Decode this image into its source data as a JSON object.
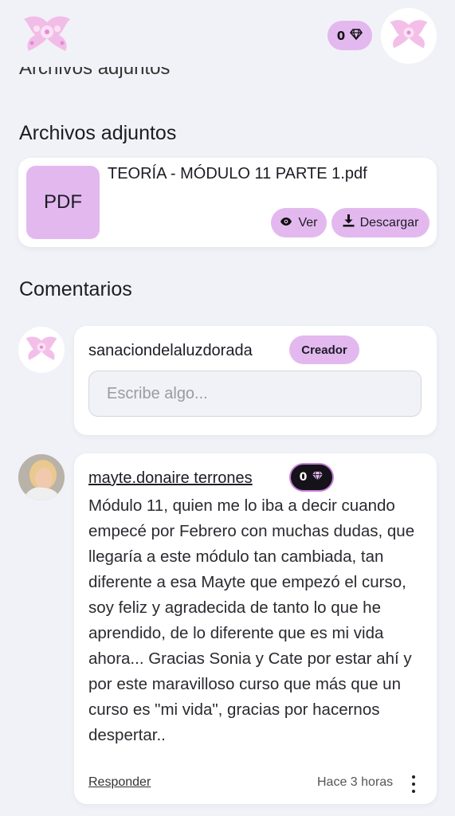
{
  "header": {
    "gem_count": "0"
  },
  "cut_heading": "Archivos adjuntos",
  "attachments": {
    "title": "Archivos adjuntos",
    "file": {
      "thumb_label": "PDF",
      "name": "TEORÍA - MÓDULO  11 PARTE 1.pdf",
      "view_label": "Ver",
      "download_label": "Descargar"
    }
  },
  "comments": {
    "title": "Comentarios",
    "composer": {
      "username": "sanaciondelaluzdorada",
      "badge": "Creador",
      "placeholder": "Escribe algo..."
    },
    "items": [
      {
        "username": "mayte.donaire terrones",
        "gem_count": "0",
        "text": "Módulo 11, quien me lo iba a decir cuando empecé por Febrero con muchas dudas, que llegaría a este módulo tan cambiada, tan diferente a esa Mayte que empezó el curso, soy feliz y agradecida de tanto lo que he aprendido, de lo diferente que es mi vida ahora... Gracias Sonia y Cate por estar ahí y por este maravilloso curso que más que un curso es \"mi vida\", gracias por hacernos despertar..",
        "reply_label": "Responder",
        "time": "Hace 3 horas"
      }
    ]
  },
  "colors": {
    "accent": "#e3b8ef",
    "background": "#f1f2f7",
    "card": "#ffffff"
  }
}
